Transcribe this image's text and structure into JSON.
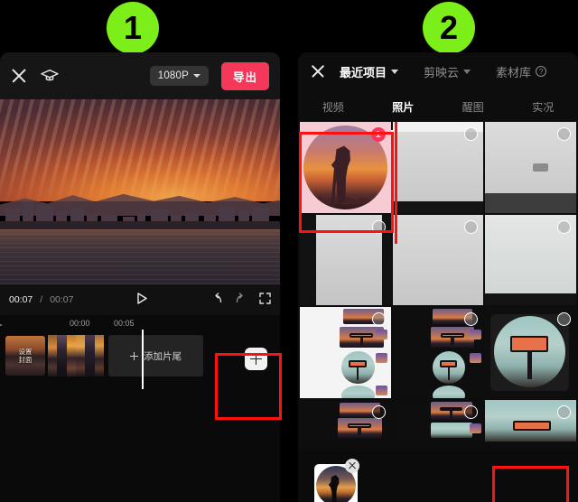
{
  "annotations": {
    "step1": "1",
    "step2": "2"
  },
  "left_panel": {
    "name": "video-editor",
    "topbar": {
      "close_icon": "close-icon",
      "tutorial_icon": "graduation-cap-icon",
      "resolution": "1080P",
      "export_label": "导出"
    },
    "preview": {
      "description": "sunset-cityscape-over-water"
    },
    "transport": {
      "current_time": "00:07",
      "separator": "/",
      "total_time": "00:07",
      "play_icon": "play-icon",
      "undo_icon": "undo-icon",
      "redo_icon": "redo-icon",
      "fullscreen_icon": "fullscreen-icon"
    },
    "timeline": {
      "ruler_marks": [
        "00:00",
        "00:05"
      ],
      "cover_label": "设置\n封面",
      "cover_line1": "设置",
      "cover_line2": "封面",
      "add_tail_label": "添加片尾",
      "add_clip_icon": "plus-icon"
    }
  },
  "right_panel": {
    "name": "media-picker",
    "header": {
      "close_icon": "close-icon",
      "tabs": [
        {
          "label": "最近项目",
          "active": true,
          "has_chevron": true
        },
        {
          "label": "剪映云",
          "active": false,
          "has_chevron": true
        },
        {
          "label": "素材库",
          "active": false,
          "has_help": true
        }
      ],
      "help_glyph": "?"
    },
    "subtabs": [
      {
        "label": "视频",
        "active": false
      },
      {
        "label": "照片",
        "active": true
      },
      {
        "label": "醒图",
        "active": false
      },
      {
        "label": "实况",
        "active": false
      }
    ],
    "grid": [
      {
        "kind": "photographer-sunset",
        "selected": true,
        "badge": "1"
      },
      {
        "kind": "screenshot-light-bars",
        "selected": false
      },
      {
        "kind": "screenshot-light-chip",
        "selected": false
      },
      {
        "kind": "screenshot-light-side",
        "selected": false
      },
      {
        "kind": "screenshot-light-plain",
        "selected": false
      },
      {
        "kind": "screenshot-light-teal",
        "selected": false
      },
      {
        "kind": "gallery-white",
        "selected": false
      },
      {
        "kind": "gallery-dark",
        "selected": false
      },
      {
        "kind": "gimbal-circle",
        "selected": false
      },
      {
        "kind": "gallery-dark-2",
        "selected": false
      },
      {
        "kind": "gallery-dark-3",
        "selected": false
      },
      {
        "kind": "gimbal-wide",
        "selected": false
      }
    ],
    "selected_bar": {
      "thumb_name": "selected-photo-thumb",
      "remove_icon": "close-icon"
    }
  }
}
